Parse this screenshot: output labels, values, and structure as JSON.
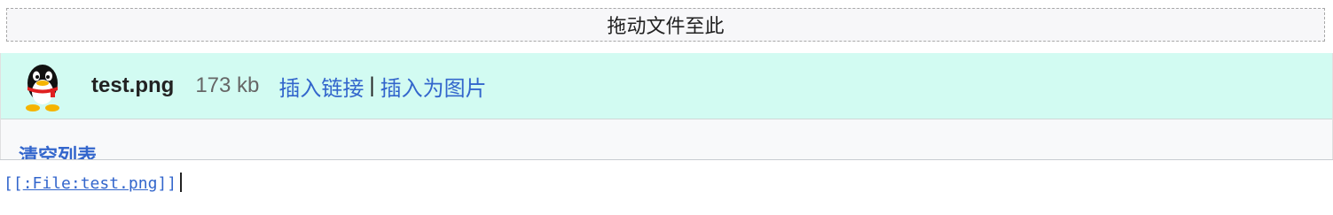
{
  "dropzone": {
    "label": "拖动文件至此"
  },
  "file": {
    "name": "test.png",
    "size": "173 kb",
    "insert_link_label": "插入链接",
    "separator": "|",
    "insert_image_label": "插入为图片"
  },
  "actions": {
    "clear_list_label": "清空列表"
  },
  "editor": {
    "open_brackets": "[[",
    "link_text": ":File:test.png",
    "close_brackets": "]]"
  }
}
